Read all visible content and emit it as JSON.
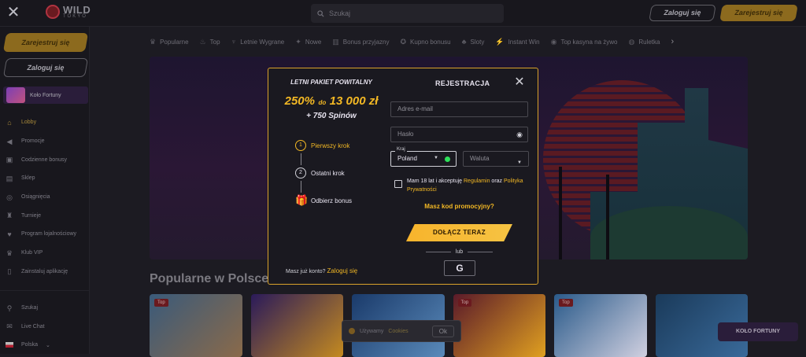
{
  "topbar": {
    "logo_text": "WILD",
    "logo_sub": "TOKYO",
    "search_placeholder": "Szukaj",
    "login_label": "Zaloguj się",
    "register_label": "Zarejestruj się"
  },
  "sidebar": {
    "register_label": "Zarejestruj się",
    "login_label": "Zaloguj się",
    "wheel_label": "Koło Fortuny",
    "items": [
      {
        "label": "Lobby",
        "icon": "home-icon"
      },
      {
        "label": "Promocje",
        "icon": "megaphone-icon"
      },
      {
        "label": "Codzienne bonusy",
        "icon": "gift-icon"
      },
      {
        "label": "Sklep",
        "icon": "shop-icon"
      },
      {
        "label": "Osiągnięcia",
        "icon": "medal-icon"
      },
      {
        "label": "Turnieje",
        "icon": "trophy-icon"
      },
      {
        "label": "Program lojalnościowy",
        "icon": "heart-icon"
      },
      {
        "label": "Klub VIP",
        "icon": "crown-icon"
      },
      {
        "label": "Zainstaluj aplikację",
        "icon": "phone-icon"
      },
      {
        "label": "Szukaj",
        "icon": "search-icon"
      },
      {
        "label": "Live Chat",
        "icon": "chat-icon"
      },
      {
        "label": "Polska",
        "icon": "flag-icon"
      }
    ]
  },
  "categories": [
    "Popularne",
    "Top",
    "Letnie Wygrane",
    "Nowe",
    "Bonus przyjazny",
    "Kupno bonusu",
    "Sloty",
    "Instant Win",
    "Top kasyna na żywo",
    "Ruletka"
  ],
  "section_title": "Popularne w Polsce",
  "games": [
    {
      "tag": "Top",
      "color1": "#3a5a7a",
      "color2": "#8a6a4a"
    },
    {
      "tag": "",
      "color1": "#2a1a5a",
      "color2": "#c48a20"
    },
    {
      "tag": "",
      "color1": "#1a3a6a",
      "color2": "#5a8aba"
    },
    {
      "tag": "Top",
      "color1": "#5a1a2a",
      "color2": "#e0a020"
    },
    {
      "tag": "Top",
      "color1": "#2a5a8a",
      "color2": "#d0d0e0"
    },
    {
      "tag": "",
      "color1": "#1a3a5a",
      "color2": "#3a6a9a"
    }
  ],
  "cookie": {
    "text_a": "Używamy",
    "text_b": "Cookies",
    "ok": "Ok"
  },
  "wheel_button": "KOŁO FORTUNY",
  "modal": {
    "promo_kicker": "LETNI PAKIET POWITALNY",
    "promo_pct": "250%",
    "promo_do": "do",
    "promo_amount": "13 000 zł",
    "promo_spins": "+ 750 Spinów",
    "steps": [
      {
        "num": "1",
        "label": "Pierwszy krok"
      },
      {
        "num": "2",
        "label": "Ostatni krok"
      },
      {
        "label": "Odbierz bonus"
      }
    ],
    "have_account": "Masz już konto?",
    "login_link": "Zaloguj się",
    "title": "REJESTRACJA",
    "email_placeholder": "Adres e-mail",
    "password_placeholder": "Hasło",
    "country_label": "Kraj",
    "country_value": "Poland",
    "currency_placeholder": "Waluta",
    "consent_a": "Mam 18 lat i akceptuję",
    "consent_link1": "Regulamin",
    "consent_b": "oraz",
    "consent_link2": "Polityka Prywatności",
    "promo_code_link": "Masz kod promocyjny?",
    "join_button": "DOŁĄCZ TERAZ",
    "or_text": "lub",
    "google_letter": "G"
  }
}
